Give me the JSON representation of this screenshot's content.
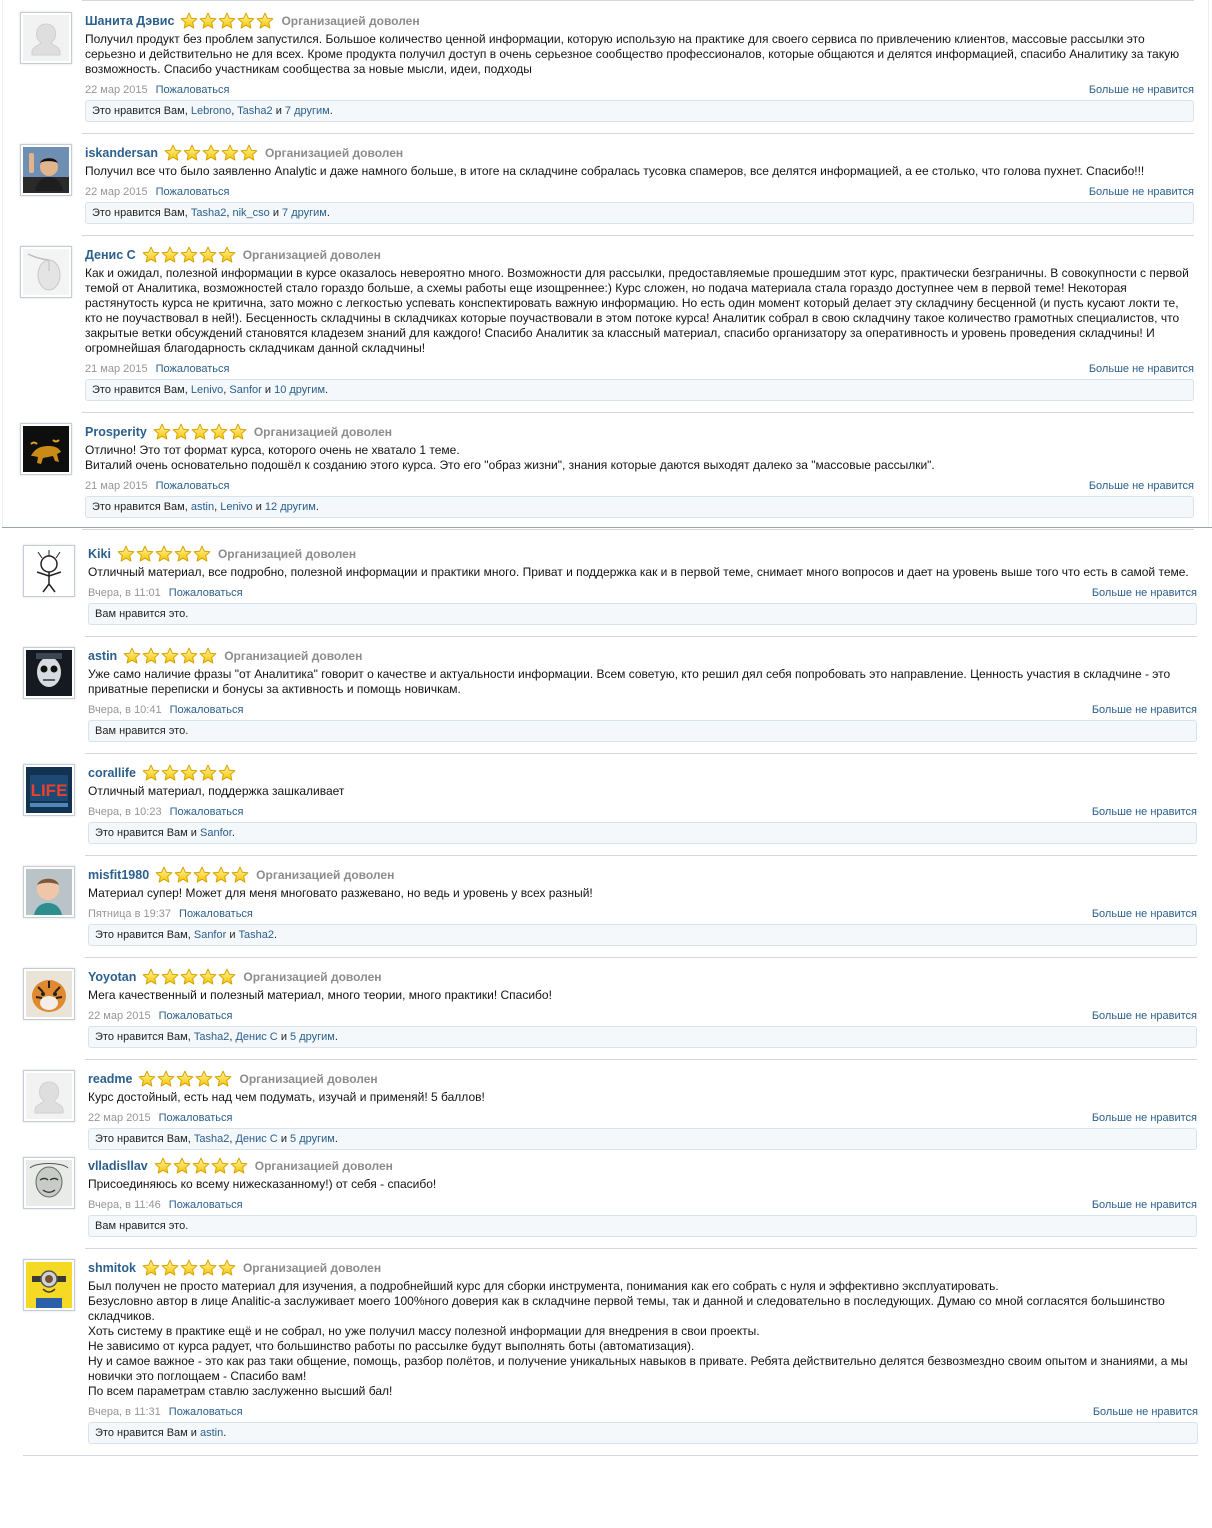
{
  "rating_text": "Организацией доволен",
  "report_label": "Пожаловаться",
  "unlike_label": "Больше не нравится",
  "reviews": [
    {
      "name": "Шанита Дэвис",
      "avatar_icon": "default-user-silhouette-icon",
      "stars": 5,
      "show_rating_text": true,
      "text": [
        "Получил продукт без проблем запустился. Большое количество ценной информации, которую использую на практике для своего сервиса по привлечению клиентов, массовые рассылки это серьезно и действительно не для всех. Кроме продукта получил доступ в очень серьезное сообщество профессионалов, которые общаются и делятся информацией, спасибо Аналитику за такую возможность. Спасибо участникам сообщества за новые мысли, идеи, подходы"
      ],
      "date": "22 мар 2015",
      "likes": {
        "prefix": "Это нравится Вам, ",
        "users": [
          "Lebrono",
          "Tasha2"
        ],
        "joiner": " и ",
        "others": "7 другим",
        "suffix": "."
      }
    },
    {
      "name": "iskandersan",
      "avatar_icon": "waving-man-avatar",
      "stars": 5,
      "show_rating_text": true,
      "text": [
        "Получил все что было заявленно Analytic и даже намного больше, в итоге на складчине собралась тусовка спамеров, все делятся информацией, а ее столько, что голова пухнет. Спасибо!!!"
      ],
      "date": "22 мар 2015",
      "likes": {
        "prefix": "Это нравится Вам, ",
        "users": [
          "Tasha2",
          "nik_cso"
        ],
        "joiner": " и ",
        "others": "7 другим",
        "suffix": "."
      }
    },
    {
      "name": "Денис С",
      "avatar_icon": "computer-mouse-avatar",
      "stars": 5,
      "show_rating_text": true,
      "text": [
        "Как и ожидал, полезной информации в курсе оказалось невероятно много. Возможности для рассылки, предоставляемые прошедшим этот курс, практически безграничны. В совокупности с первой темой от Аналитика, возможностей стало гораздо больше, а схемы работы еще изощреннее:) Курс сложен, но подача материала стала гораздо доступнее чем в первой теме! Некоторая растянутость курса не критична, зато можно с легкостью успевать конспектировать важную информацию. Но есть один момент который делает эту складчину бесценной (и пусть кусают локти те, кто не поучаствовал в ней!). Бесценность складчины в складчиках которые поучаствовали в этом потоке курса! Аналитик собрал в свою складчину такое количество грамотных специалистов, что закрытые ветки обсуждений становятся кладезем знаний для каждого! Спасибо Аналитик за классный материал, спасибо организатору за оперативность и уровень проведения складчины! И огромнейшая благодарность складчикам данной складчины!"
      ],
      "date": "21 мар 2015",
      "likes": {
        "prefix": "Это нравится Вам, ",
        "users": [
          "Lenivo",
          "Sanfor"
        ],
        "joiner": " и ",
        "others": "10 другим",
        "suffix": "."
      }
    },
    {
      "name": "Prosperity",
      "avatar_icon": "golden-bull-avatar",
      "stars": 5,
      "show_rating_text": true,
      "text": [
        "Отлично! Это тот формат курса, которого очень не хватало 1 теме.",
        "Виталий очень основательно подошёл к созданию этого курса. Это его \"образ жизни\", знания которые даются выходят далеко за \"массовые рассылки\"."
      ],
      "date": "21 мар 2015",
      "likes": {
        "prefix": "Это нравится Вам, ",
        "users": [
          "astin",
          "Lenivo"
        ],
        "joiner": " и ",
        "others": "12 другим",
        "suffix": "."
      }
    },
    {
      "name": "Kiki",
      "avatar_icon": "cartoon-character-avatar",
      "stars": 5,
      "show_rating_text": true,
      "text": [
        "Отличный материал, все подробно, полезной информации и практики много. Приват и поддержка как и в первой теме, снимает много вопросов и дает на уровень выше того что есть в самой теме."
      ],
      "date": "Вчера, в 11:01",
      "likes": {
        "prefix": "Вам нравится это.",
        "users": [],
        "joiner": "",
        "others": "",
        "suffix": ""
      }
    },
    {
      "name": "astin",
      "avatar_icon": "skull-face-avatar",
      "stars": 5,
      "show_rating_text": true,
      "text": [
        "Уже само наличие фразы \"от Аналитика\" говорит о качестве и актуальности информации. Всем советую, кто решил дял себя попробовать это направление. Ценность участия в складчине - это приватные переписки и бонусы за активность и помощь новичкам."
      ],
      "date": "Вчера, в 10:41",
      "likes": {
        "prefix": "Вам нравится это.",
        "users": [],
        "joiner": "",
        "others": "",
        "suffix": ""
      }
    },
    {
      "name": "corallife",
      "avatar_icon": "life-poster-avatar",
      "stars": 5,
      "show_rating_text": false,
      "text": [
        "Отличный материал, поддержка зашкаливает"
      ],
      "date": "Вчера, в 10:23",
      "likes": {
        "prefix": "Это нравится Вам и ",
        "users": [
          "Sanfor"
        ],
        "joiner": "",
        "others": "",
        "suffix": "."
      }
    },
    {
      "name": "misfit1980",
      "avatar_icon": "baby-photo-avatar",
      "stars": 5,
      "show_rating_text": true,
      "text": [
        "Материал супер! Может для меня многовато разжевано, но ведь и уровень у всех разный!"
      ],
      "date": "Пятница в 19:37",
      "likes": {
        "prefix": "Это нравится Вам, ",
        "users": [
          "Sanfor",
          "Tasha2"
        ],
        "joiner": " и ",
        "others": "",
        "suffix": "."
      }
    },
    {
      "name": "Yoyotan",
      "avatar_icon": "tiger-avatar",
      "stars": 5,
      "show_rating_text": true,
      "text": [
        "Мега качественный и полезный материал, много теории, много практики! Спасибо!"
      ],
      "date": "22 мар 2015",
      "likes": {
        "prefix": "Это нравится Вам, ",
        "users": [
          "Tasha2",
          "Денис С"
        ],
        "joiner": " и ",
        "others": "5 другим",
        "suffix": "."
      }
    },
    {
      "name": "readme",
      "avatar_icon": "default-user-silhouette-icon",
      "stars": 5,
      "show_rating_text": true,
      "text": [
        "Курс достойный, есть над чем подумать, изучай и применяй! 5 баллов!"
      ],
      "date": "22 мар 2015",
      "likes": {
        "prefix": "Это нравится Вам, ",
        "users": [
          "Tasha2",
          "Денис С"
        ],
        "joiner": " и ",
        "others": "5 другим",
        "suffix": "."
      }
    },
    {
      "name": "vlladisllav",
      "avatar_icon": "sketch-face-avatar",
      "stars": 5,
      "show_rating_text": true,
      "text": [
        "Присоединяюсь ко всему нижесказанному!) от себя - спасибо!"
      ],
      "date": "Вчера, в 11:46",
      "likes": {
        "prefix": "Вам нравится это.",
        "users": [],
        "joiner": "",
        "others": "",
        "suffix": ""
      }
    },
    {
      "name": "shmitok",
      "avatar_icon": "minion-avatar",
      "stars": 5,
      "show_rating_text": true,
      "text": [
        "Был получен не просто материал для изучения, а подробнейший курс для сборки инструмента, понимания как его собрать с нуля и эффективно эксплуатировать.",
        "Безусловно автор в лице Analitic-а заслуживает моего 100%ного доверия как в складчине первой темы, так и данной и следовательно в последующих. Думаю со мной согласятся большинство складчиков.",
        "Хоть систему в практике ещё и не собрал, но уже получил массу полезной информации для внедрения в свои проекты.",
        "Не зависимо от курса радует, что большинство работы по рассылке будут выполнять боты (автоматизация).",
        "Ну и самое важное - это как раз таки общение, помощь, разбор полётов, и получение уникальных навыков в привате. Ребята действительно делятся безвозмездно своим опытом и знаниями, а мы новички это поглощаем - Спасибо вам!",
        "По всем параметрам ставлю заслуженно высший бал!"
      ],
      "date": "Вчера, в 11:31",
      "likes": {
        "prefix": "Это нравится Вам и ",
        "users": [
          "astin"
        ],
        "joiner": "",
        "others": "",
        "suffix": "."
      }
    }
  ]
}
